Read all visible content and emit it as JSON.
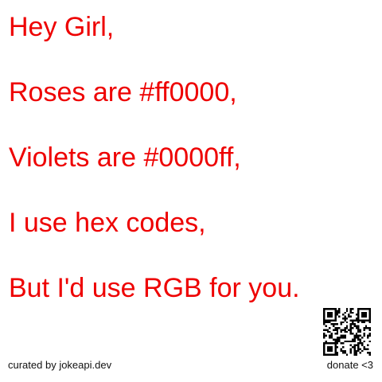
{
  "joke": {
    "lines": [
      "Hey Girl,",
      "Roses are #ff0000,",
      "Violets are #0000ff,",
      "I use hex codes,",
      "But I'd use RGB for you."
    ]
  },
  "footer": {
    "credit": "curated by jokeapi.dev",
    "donate": "donate <3"
  },
  "colors": {
    "text": "#ee0000",
    "background": "#ffffff",
    "footer_text": "#111111"
  },
  "icons": {
    "qr": "qr-code-icon"
  }
}
